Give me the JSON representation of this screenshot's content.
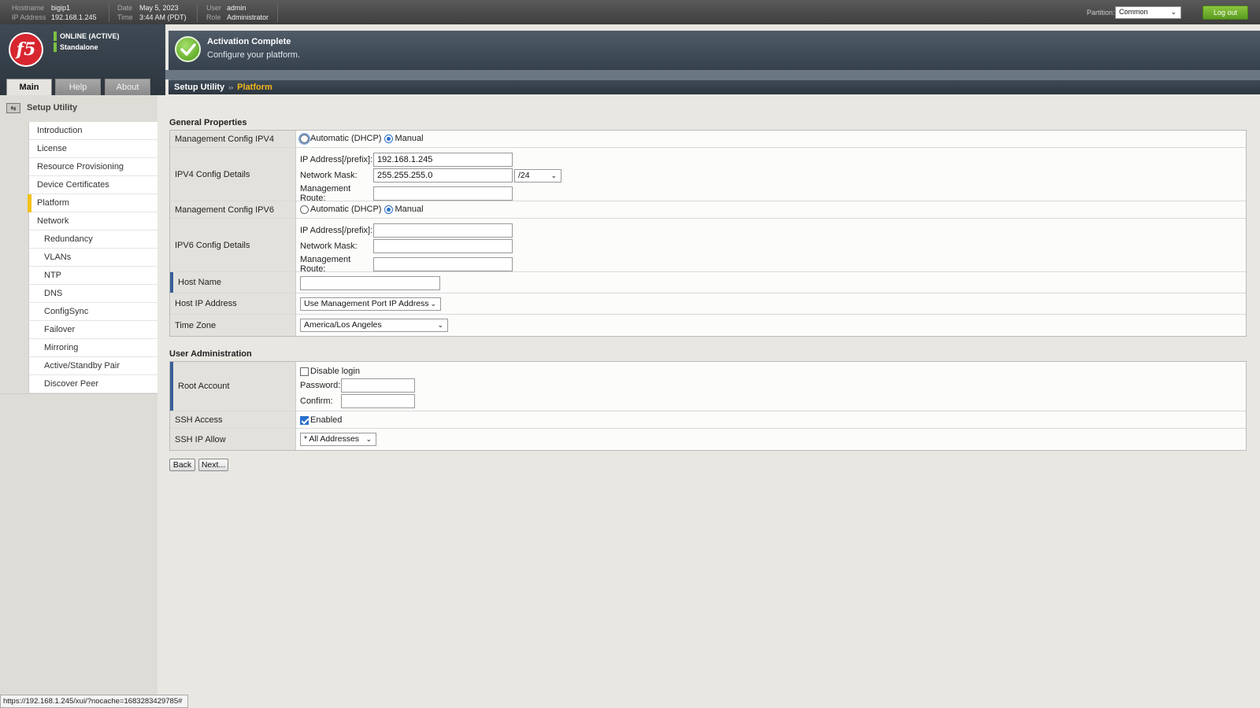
{
  "topbar": {
    "hostname_label": "Hostname",
    "hostname": "bigip1",
    "ip_label": "IP Address",
    "ip": "192.168.1.245",
    "date_label": "Date",
    "date": "May 5, 2023",
    "time_label": "Time",
    "time": "3:44 AM (PDT)",
    "user_label": "User",
    "user": "admin",
    "role_label": "Role",
    "role": "Administrator",
    "partition_label": "Partition:",
    "partition": "Common",
    "logout": "Log out"
  },
  "header": {
    "logo": "f5",
    "status_online": "ONLINE (ACTIVE)",
    "status_mode": "Standalone",
    "banner_title": "Activation Complete",
    "banner_sub": "Configure your platform."
  },
  "tabs": [
    {
      "label": "Main"
    },
    {
      "label": "Help"
    },
    {
      "label": "About"
    }
  ],
  "breadcrumb": {
    "first": "Setup Utility",
    "sep": "››",
    "current": "Platform"
  },
  "sidebar": {
    "header": "Setup Utility",
    "items": [
      {
        "label": "Introduction"
      },
      {
        "label": "License"
      },
      {
        "label": "Resource Provisioning"
      },
      {
        "label": "Device Certificates"
      },
      {
        "label": "Platform"
      },
      {
        "label": "Network"
      },
      {
        "label": "Redundancy"
      },
      {
        "label": "VLANs"
      },
      {
        "label": "NTP"
      },
      {
        "label": "DNS"
      },
      {
        "label": "ConfigSync"
      },
      {
        "label": "Failover"
      },
      {
        "label": "Mirroring"
      },
      {
        "label": "Active/Standby Pair"
      },
      {
        "label": "Discover Peer"
      }
    ]
  },
  "general": {
    "title": "General Properties",
    "mgmt_ipv4_label": "Management Config IPV4",
    "auto_dhcp": "Automatic (DHCP)",
    "manual": "Manual",
    "ipv4_details_label": "IPV4 Config Details",
    "ip_prefix_label": "IP Address[/prefix]:",
    "ipv4_ip": "192.168.1.245",
    "netmask_label": "Network Mask:",
    "ipv4_mask": "255.255.255.0",
    "ipv4_prefix": "/24",
    "route_label": "Management Route:",
    "ipv4_route": "",
    "mgmt_ipv6_label": "Management Config IPV6",
    "ipv6_details_label": "IPV6 Config Details",
    "ipv6_ip": "",
    "ipv6_mask": "",
    "ipv6_route": "",
    "hostname_label": "Host Name",
    "hostname_value": "",
    "host_ip_label": "Host IP Address",
    "host_ip_value": "Use Management Port IP Address",
    "timezone_label": "Time Zone",
    "timezone_value": "America/Los Angeles"
  },
  "user_admin": {
    "title": "User Administration",
    "root_label": "Root Account",
    "disable_login": "Disable login",
    "password_label": "Password:",
    "confirm_label": "Confirm:",
    "ssh_access_label": "SSH Access",
    "ssh_enabled": "Enabled",
    "ssh_allow_label": "SSH IP Allow",
    "ssh_allow_value": "* All Addresses"
  },
  "buttons": {
    "back": "Back",
    "next": "Next..."
  },
  "statusbar": {
    "url": "https://192.168.1.245/xui/?nocache=1683283429785#"
  },
  "colors": {
    "accent_green": "#7ac143",
    "breadcrumb_current": "#f3b71b",
    "required_marker": "#3a5f9a",
    "logo_red": "#d7262f"
  }
}
